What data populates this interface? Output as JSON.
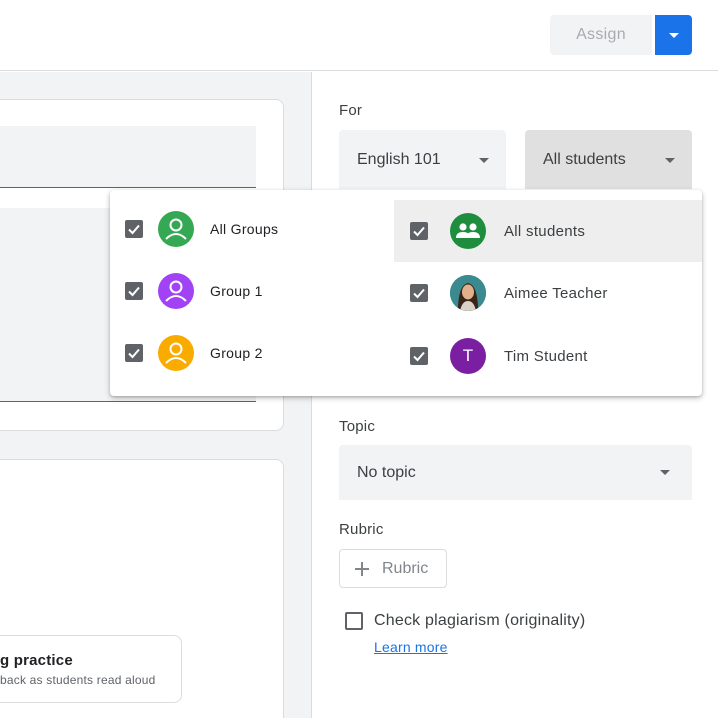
{
  "header": {
    "assign_label": "Assign"
  },
  "left": {
    "practice_title": "g practice",
    "practice_subtitle": "back as students read aloud"
  },
  "form": {
    "for_label": "For",
    "class_value": "English 101",
    "students_value": "All students",
    "topic_label": "Topic",
    "topic_value": "No topic",
    "rubric_label": "Rubric",
    "rubric_button": "Rubric",
    "plagiarism_label": "Check plagiarism (originality)",
    "learn_more": "Learn more"
  },
  "dropdown": {
    "groups": [
      {
        "label": "All Groups",
        "checked": true,
        "color": "#34a853"
      },
      {
        "label": "Group 1",
        "checked": true,
        "color": "#a142f4"
      },
      {
        "label": "Group 2",
        "checked": true,
        "color": "#f9ab00"
      }
    ],
    "students": [
      {
        "label": "All students",
        "checked": true,
        "color": "#1e8e3e",
        "icon": "group-icon"
      },
      {
        "label": "Aimee Teacher",
        "checked": true,
        "icon": "photo-avatar"
      },
      {
        "label": "Tim Student",
        "checked": true,
        "color": "#7b1fa2",
        "initial": "T"
      }
    ]
  },
  "colors": {
    "accent": "#1a73e8",
    "field_bg": "#f1f3f4"
  }
}
